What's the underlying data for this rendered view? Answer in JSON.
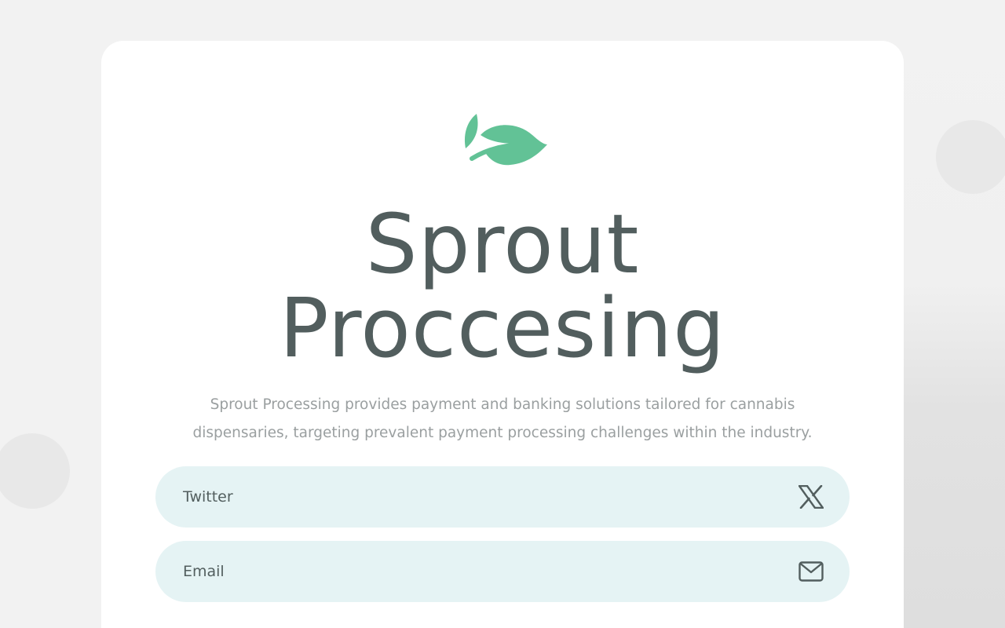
{
  "brand": {
    "logo_icon": "leaf-logo-icon",
    "accent_color": "#62c296",
    "title_line1": "Sprout",
    "title_line2": "Proccesing",
    "description": "Sprout Processing provides payment and banking solutions tailored for cannabis dispensaries, targeting prevalent payment processing challenges within the industry."
  },
  "links": [
    {
      "label": "Twitter",
      "icon": "x-twitter-icon"
    },
    {
      "label": "Email",
      "icon": "envelope-icon"
    }
  ],
  "colors": {
    "page_background": "#f2f2f2",
    "card_background": "#ffffff",
    "pill_background": "#e5f3f4",
    "text_dark": "#525e5e",
    "text_muted": "#9a9fa0"
  }
}
